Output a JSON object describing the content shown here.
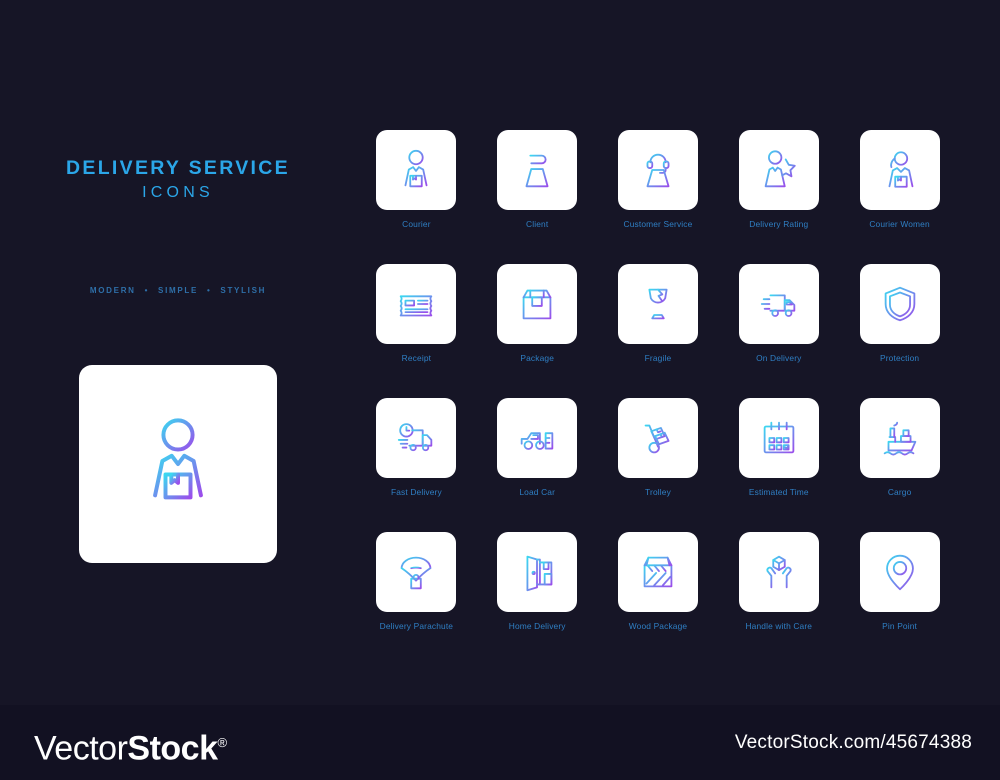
{
  "colors": {
    "background": "#161526",
    "footer_background": "#121122",
    "card_background": "#ffffff",
    "title": "#2BA6E8",
    "tagline": "#2E6FA8",
    "label": "#2F7FC4",
    "gradient_start": "#3BD8F0",
    "gradient_end": "#9B4DEB"
  },
  "header": {
    "title": "DELIVERY SERVICE",
    "subtitle": "ICONS",
    "tagline": [
      "MODERN",
      "SIMPLE",
      "STYLISH"
    ],
    "tagline_separator": "•"
  },
  "hero": {
    "icon": "courier-icon",
    "label": "Courier"
  },
  "icons": [
    {
      "label": "Courier",
      "icon": "courier-icon"
    },
    {
      "label": "Client",
      "icon": "client-icon"
    },
    {
      "label": "Customer Service",
      "icon": "customer-service-icon"
    },
    {
      "label": "Delivery Rating",
      "icon": "delivery-rating-icon"
    },
    {
      "label": "Courier Women",
      "icon": "courier-women-icon"
    },
    {
      "label": "Receipt",
      "icon": "receipt-icon"
    },
    {
      "label": "Package",
      "icon": "package-icon"
    },
    {
      "label": "Fragile",
      "icon": "fragile-icon"
    },
    {
      "label": "On Delivery",
      "icon": "on-delivery-truck-icon"
    },
    {
      "label": "Protection",
      "icon": "protection-shield-icon"
    },
    {
      "label": "Fast Delivery",
      "icon": "fast-delivery-icon"
    },
    {
      "label": "Load Car",
      "icon": "load-car-icon"
    },
    {
      "label": "Trolley",
      "icon": "trolley-icon"
    },
    {
      "label": "Estimated Time",
      "icon": "estimated-time-calendar-icon"
    },
    {
      "label": "Cargo",
      "icon": "cargo-ship-icon"
    },
    {
      "label": "Delivery Parachute",
      "icon": "delivery-parachute-icon"
    },
    {
      "label": "Home Delivery",
      "icon": "home-delivery-door-icon"
    },
    {
      "label": "Wood Package",
      "icon": "wood-package-icon"
    },
    {
      "label": "Handle with Care",
      "icon": "handle-with-care-icon"
    },
    {
      "label": "Pin Point",
      "icon": "pin-point-icon"
    }
  ],
  "footer": {
    "brand_light": "Vector",
    "brand_bold": "Stock",
    "registered_mark": "®",
    "watermark_url": "VectorStock.com/45674388"
  }
}
